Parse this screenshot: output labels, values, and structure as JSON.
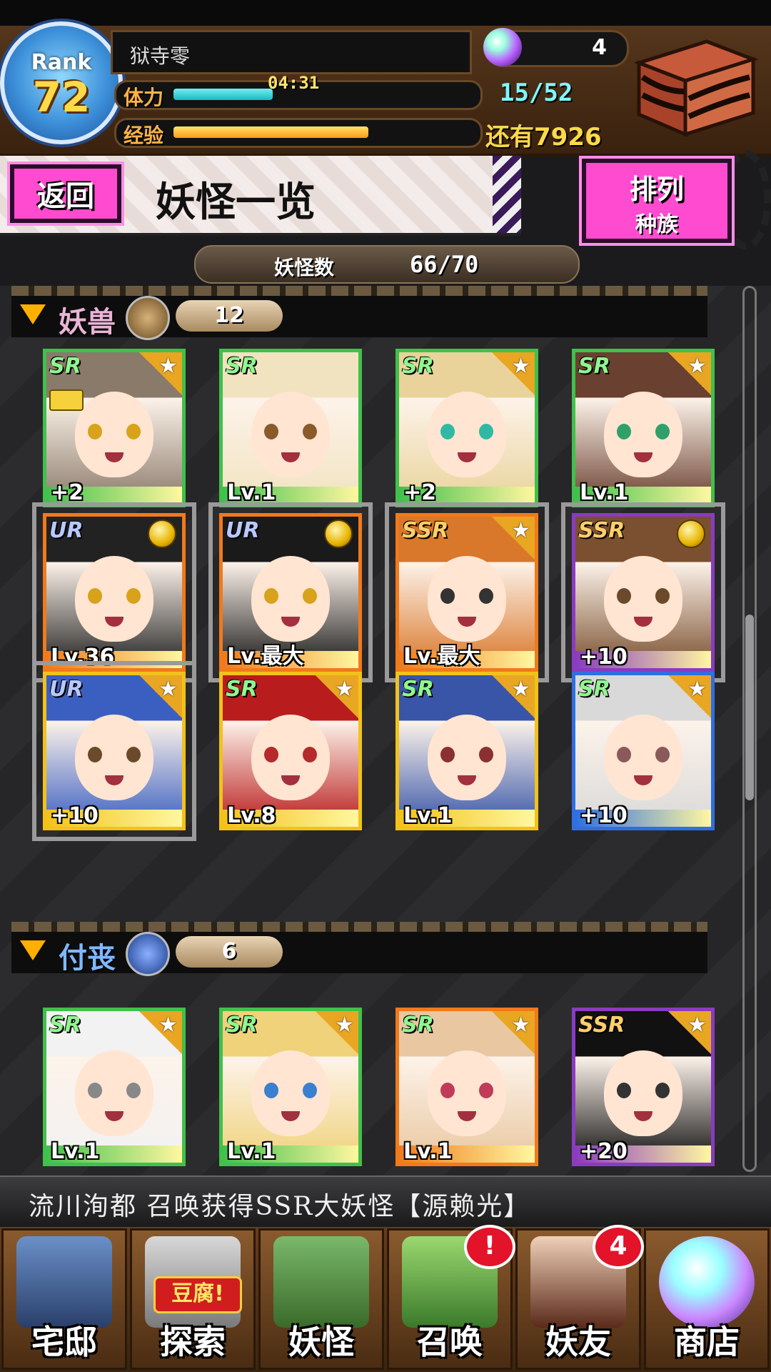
{
  "header": {
    "rank_label": "Rank",
    "rank_value": "72",
    "player_name": "狱寺零",
    "stamina_label": "体力",
    "stamina_timer": "04:31",
    "stamina_fill": 0.33,
    "stamina_count": "15/52",
    "exp_label": "经验",
    "exp_fill": 0.65,
    "exp_remaining": "还有7926",
    "orb_count": "4"
  },
  "titlebar": {
    "back_label": "返回",
    "page_title": "妖怪一览",
    "sort_label": "排列",
    "sort_value": "种族"
  },
  "count": {
    "label": "妖怪数",
    "value": "66/70"
  },
  "groups": [
    {
      "name": "妖兽",
      "name_color": "#e9b4d6",
      "count": "12",
      "cards": [
        {
          "rarity": "SR",
          "level": "+2",
          "color": "#41c04b",
          "badge": "star",
          "locked": true
        },
        {
          "rarity": "SR",
          "level": "Lv.1",
          "color": "#41c04b",
          "badge": "none",
          "locked": false
        },
        {
          "rarity": "SR",
          "level": "+2",
          "color": "#41c04b",
          "badge": "star",
          "locked": false
        },
        {
          "rarity": "SR",
          "level": "Lv.1",
          "color": "#41c04b",
          "badge": "star",
          "locked": false
        },
        {
          "rarity": "UR",
          "level": "Lv.36",
          "color": "#f07a1c",
          "badge": "medal",
          "locked": false
        },
        {
          "rarity": "UR",
          "level": "Lv.最大",
          "color": "#f07a1c",
          "badge": "medal",
          "locked": false
        },
        {
          "rarity": "SSR",
          "level": "Lv.最大",
          "color": "#f07a1c",
          "badge": "star",
          "locked": false
        },
        {
          "rarity": "SSR",
          "level": "+10",
          "color": "#8a3bc0",
          "badge": "medal",
          "locked": false
        },
        {
          "rarity": "UR",
          "level": "+10",
          "color": "#f2c21a",
          "badge": "star",
          "locked": false
        },
        {
          "rarity": "SR",
          "level": "Lv.8",
          "color": "#f2c21a",
          "badge": "star",
          "locked": false
        },
        {
          "rarity": "SR",
          "level": "Lv.1",
          "color": "#f2c21a",
          "badge": "star",
          "locked": false
        },
        {
          "rarity": "SR",
          "level": "+10",
          "color": "#2f6fe0",
          "badge": "star",
          "locked": false
        }
      ]
    },
    {
      "name": "付丧",
      "name_color": "#7fb8ff",
      "count": "6",
      "cards": [
        {
          "rarity": "SR",
          "level": "Lv.1",
          "color": "#41c04b",
          "badge": "star",
          "locked": false
        },
        {
          "rarity": "SR",
          "level": "Lv.1",
          "color": "#41c04b",
          "badge": "star",
          "locked": false
        },
        {
          "rarity": "SR",
          "level": "Lv.1",
          "color": "#f07a1c",
          "badge": "star",
          "locked": false
        },
        {
          "rarity": "SSR",
          "level": "+20",
          "color": "#8a3bc0",
          "badge": "star",
          "locked": false
        }
      ]
    }
  ],
  "ticker": "流川洵都 召唤获得SSR大妖怪【源赖光】",
  "nav": [
    {
      "label": "宅邸",
      "icon": "mansion-icon"
    },
    {
      "label": "探索",
      "icon": "explore-map-icon",
      "tag": "豆腐!"
    },
    {
      "label": "妖怪",
      "icon": "yokai-scroll-icon"
    },
    {
      "label": "召唤",
      "icon": "pentagram-icon",
      "badge": "!"
    },
    {
      "label": "妖友",
      "icon": "friend-girl-icon",
      "badge": "4"
    },
    {
      "label": "商店",
      "icon": "orb-shop-icon"
    }
  ]
}
